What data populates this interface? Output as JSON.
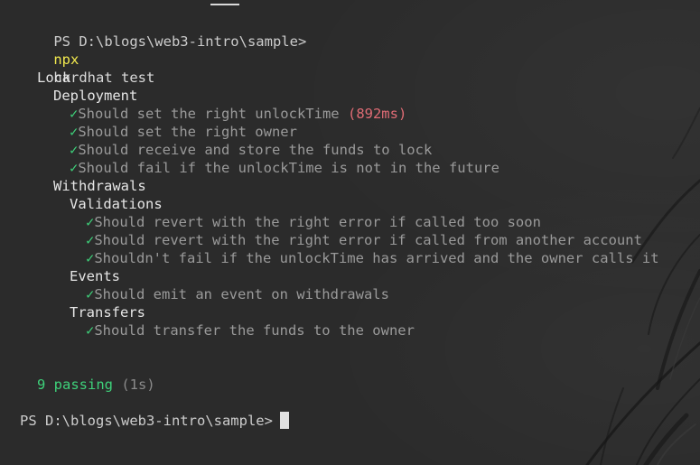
{
  "prompt": "PS D:\\blogs\\web3-intro\\sample>",
  "command": {
    "program": "npx",
    "args": "hardhat test"
  },
  "suites": {
    "root": "Lock",
    "deployment": "Deployment",
    "withdrawals": "Withdrawals",
    "validations": "Validations",
    "events": "Events",
    "transfers": "Transfers"
  },
  "check_glyph": "✓",
  "tests": {
    "deployment": [
      "Should set the right unlockTime",
      "Should set the right owner",
      "Should receive and store the funds to lock",
      "Should fail if the unlockTime is not in the future"
    ],
    "deployment_slow": "(892ms)",
    "validations": [
      "Should revert with the right error if called too soon",
      "Should revert with the right error if called from another account",
      "Shouldn't fail if the unlockTime has arrived and the owner calls it"
    ],
    "events": [
      "Should emit an event on withdrawals"
    ],
    "transfers": [
      "Should transfer the funds to the owner"
    ]
  },
  "summary": {
    "passing": "9 passing",
    "duration": "(1s)"
  },
  "colors": {
    "background": "#2b2b2b",
    "command": "#f2e94e",
    "check": "#3ed17a",
    "slow": "#e06c75",
    "passing": "#3ed17a"
  }
}
